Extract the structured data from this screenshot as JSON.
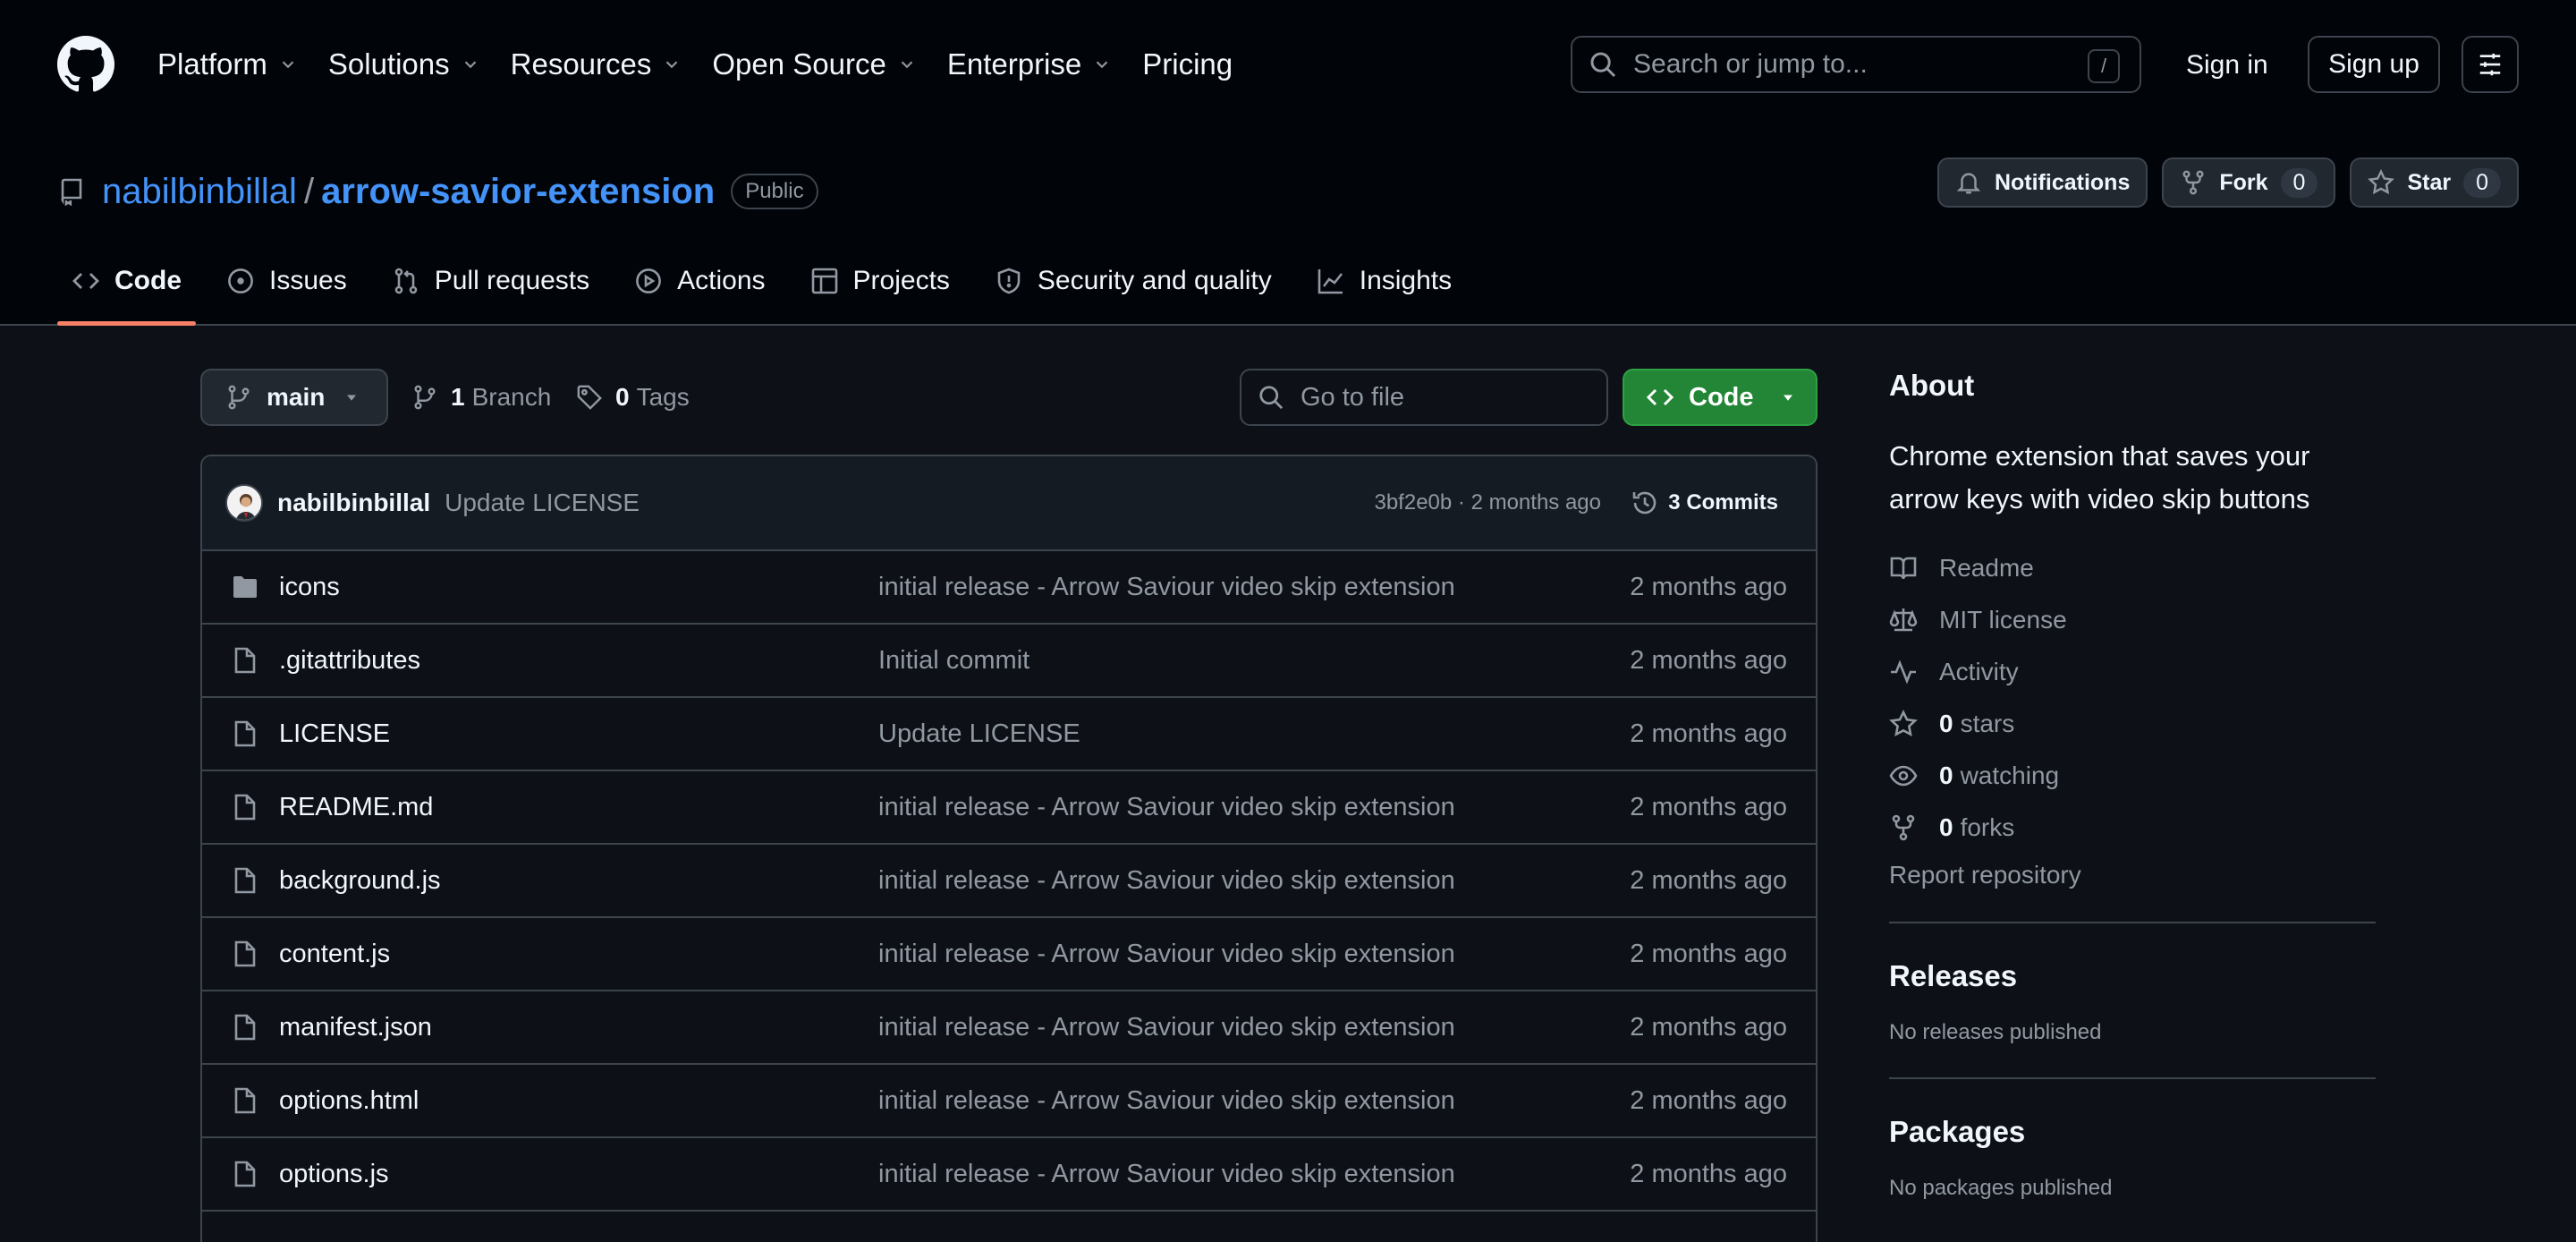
{
  "header": {
    "nav": [
      {
        "label": "Platform",
        "dropdown": true
      },
      {
        "label": "Solutions",
        "dropdown": true
      },
      {
        "label": "Resources",
        "dropdown": true
      },
      {
        "label": "Open Source",
        "dropdown": true
      },
      {
        "label": "Enterprise",
        "dropdown": true
      },
      {
        "label": "Pricing",
        "dropdown": false
      }
    ],
    "search_placeholder": "Search or jump to...",
    "search_shortcut": "/",
    "sign_in": "Sign in",
    "sign_up": "Sign up"
  },
  "repo": {
    "owner": "nabilbinbillal",
    "separator": "/",
    "name": "arrow-savior-extension",
    "visibility": "Public",
    "notifications_label": "Notifications",
    "fork_label": "Fork",
    "fork_count": "0",
    "star_label": "Star",
    "star_count": "0",
    "tabs": [
      {
        "label": "Code",
        "icon": "code-icon",
        "active": true
      },
      {
        "label": "Issues",
        "icon": "issue-icon",
        "active": false
      },
      {
        "label": "Pull requests",
        "icon": "pull-request-icon",
        "active": false
      },
      {
        "label": "Actions",
        "icon": "play-icon",
        "active": false
      },
      {
        "label": "Projects",
        "icon": "table-icon",
        "active": false
      },
      {
        "label": "Security and quality",
        "icon": "shield-icon",
        "active": false
      },
      {
        "label": "Insights",
        "icon": "graph-icon",
        "active": false
      }
    ]
  },
  "toolbar": {
    "branch": "main",
    "branch_count": "1",
    "branch_label": "Branch",
    "tag_count": "0",
    "tag_label": "Tags",
    "file_search_placeholder": "Go to file",
    "code_button": "Code"
  },
  "latest_commit": {
    "author": "nabilbinbillal",
    "message": "Update LICENSE",
    "sha_and_time": "3bf2e0b · 2 months ago",
    "commits_label": "3 Commits"
  },
  "files": [
    {
      "name": "icons",
      "type": "folder",
      "commit": "initial release - Arrow Saviour video skip extension",
      "age": "2 months ago"
    },
    {
      "name": ".gitattributes",
      "type": "file",
      "commit": "Initial commit",
      "age": "2 months ago"
    },
    {
      "name": "LICENSE",
      "type": "file",
      "commit": "Update LICENSE",
      "age": "2 months ago"
    },
    {
      "name": "README.md",
      "type": "file",
      "commit": "initial release - Arrow Saviour video skip extension",
      "age": "2 months ago"
    },
    {
      "name": "background.js",
      "type": "file",
      "commit": "initial release - Arrow Saviour video skip extension",
      "age": "2 months ago"
    },
    {
      "name": "content.js",
      "type": "file",
      "commit": "initial release - Arrow Saviour video skip extension",
      "age": "2 months ago"
    },
    {
      "name": "manifest.json",
      "type": "file",
      "commit": "initial release - Arrow Saviour video skip extension",
      "age": "2 months ago"
    },
    {
      "name": "options.html",
      "type": "file",
      "commit": "initial release - Arrow Saviour video skip extension",
      "age": "2 months ago"
    },
    {
      "name": "options.js",
      "type": "file",
      "commit": "initial release - Arrow Saviour video skip extension",
      "age": "2 months ago"
    }
  ],
  "about": {
    "heading": "About",
    "description": "Chrome extension that saves your arrow keys with video skip buttons",
    "readme": "Readme",
    "license": "MIT license",
    "activity": "Activity",
    "stars_count": "0",
    "stars_label": "stars",
    "watching_count": "0",
    "watching_label": "watching",
    "forks_count": "0",
    "forks_label": "forks",
    "report": "Report repository"
  },
  "releases": {
    "heading": "Releases",
    "empty": "No releases published"
  },
  "packages": {
    "heading": "Packages",
    "empty": "No packages published"
  },
  "colors": {
    "background": "#0d1117",
    "header": "#010409",
    "link": "#4493f8",
    "primary_button": "#238636",
    "active_tab_underline": "#f78166",
    "border": "#3d444d"
  }
}
